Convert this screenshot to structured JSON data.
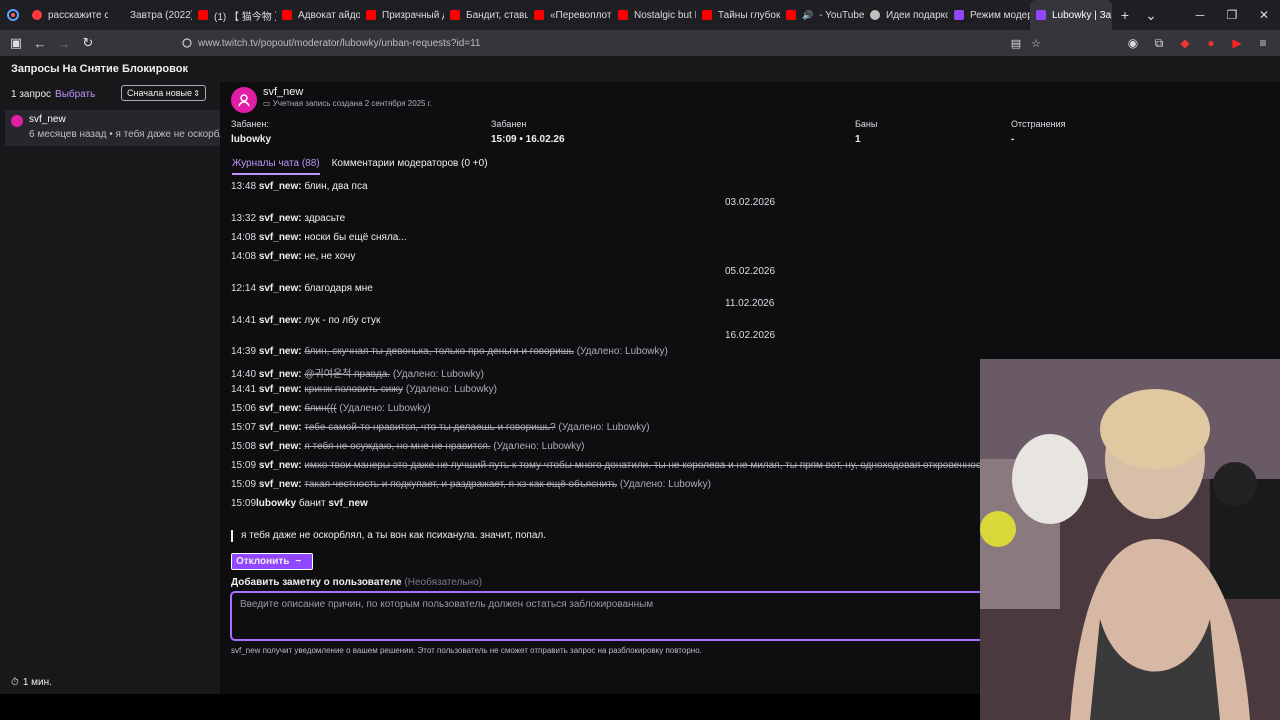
{
  "browser": {
    "tabs": [
      {
        "label": "расскажите са",
        "color": "#ff3b3b"
      },
      {
        "label": "Завтра (2022)",
        "color": "#ffffff"
      },
      {
        "label": "(1) 【 猫今物 】",
        "color": "#ff0000"
      },
      {
        "label": "Адвокат айдол",
        "color": "#ff0000"
      },
      {
        "label": "Призрачный д",
        "color": "#ff0000"
      },
      {
        "label": "Бандит, ставш",
        "color": "#ff0000"
      },
      {
        "label": "«Перевоплоти",
        "color": "#ff0000"
      },
      {
        "label": "Nostalgic but N",
        "color": "#ff0000"
      },
      {
        "label": "Тайны глубок",
        "color": "#ff0000"
      },
      {
        "label": "- YouTube",
        "color": "#ff0000"
      },
      {
        "label": "Идеи подарко",
        "color": "#c0c0c0"
      },
      {
        "label": "Режим модера",
        "color": "#9146ff"
      },
      {
        "label": "Lubowky | Зa",
        "color": "#9146ff"
      }
    ],
    "url": "www.twitch.tv/popout/moderator/lubowky/unban-requests?id=11"
  },
  "page": {
    "title": "Запросы На Снятие Блокировок"
  },
  "sidebar": {
    "count": "1 запрос",
    "select": "Выбрать",
    "sort": "Сначала новые",
    "request": {
      "name": "svf_new",
      "meta": "6 месяцев назад • я тебя даже не оскорбл"
    },
    "timer": "1 мин."
  },
  "user": {
    "name": "svf_new",
    "created": "Учетная запись создана 2 сентября 2025 г.",
    "banned_by_label": "Забанен:",
    "banned_by": "lubowky",
    "banned_at_label": "Забанен",
    "banned_at": "15:09 • 16.02.26",
    "bans_label": "Баны",
    "bans": "1",
    "timeouts_label": "Отстранения",
    "timeouts": "-"
  },
  "tabs": {
    "chat_logs": "Журналы чата (88)",
    "mod_comments": "Комментарии модераторов (0 +0)"
  },
  "log": {
    "lines": [
      {
        "ts": "13:48",
        "user": "svf_new:",
        "text": "блин, два пса",
        "deleted": false,
        "by": ""
      },
      {
        "ts": "13:32",
        "user": "svf_new:",
        "text": "здрасьте",
        "deleted": false,
        "by": ""
      },
      {
        "ts": "14:08",
        "user": "svf_new:",
        "text": "носки бы ещё сняла...",
        "deleted": false,
        "by": ""
      },
      {
        "ts": "14:08",
        "user": "svf_new:",
        "text": "не, не хочу",
        "deleted": false,
        "by": ""
      },
      {
        "ts": "12:14",
        "user": "svf_new:",
        "text": "благодаря мне",
        "deleted": false,
        "by": ""
      },
      {
        "ts": "14:41",
        "user": "svf_new:",
        "text": "лук - по лбу стук",
        "deleted": false,
        "by": ""
      },
      {
        "ts": "14:39",
        "user": "svf_new:",
        "text": "блин, скучная ты девонька, только про деньги и говоришь",
        "deleted": true,
        "by": "(Удалено: Lubowky)"
      },
      {
        "ts": "14:40",
        "user": "svf_new:",
        "text": "@귀여운척 правда.",
        "deleted": true,
        "by": "(Удалено: Lubowky)"
      },
      {
        "ts": "14:41",
        "user": "svf_new:",
        "text": "кринж половить сижу",
        "deleted": true,
        "by": "(Удалено: Lubowky)"
      },
      {
        "ts": "15:06",
        "user": "svf_new:",
        "text": "блин(((",
        "deleted": true,
        "by": "(Удалено: Lubowky)"
      },
      {
        "ts": "15:07",
        "user": "svf_new:",
        "text": "тебе самой-то нравится, что ты делаешь и говоришь?",
        "deleted": true,
        "by": "(Удалено: Lubowky)"
      },
      {
        "ts": "15:08",
        "user": "svf_new:",
        "text": "я тебя не осуждаю, но мне не нравится.",
        "deleted": true,
        "by": "(Удалено: Lubowky)"
      },
      {
        "ts": "15:09",
        "user": "svf_new:",
        "text": "имхо твои манеры это даже не лучший путь к тому чтобы много донатили. ты не королева и не милая, ты прям вот, ну, одноходовая откровенность",
        "deleted": true,
        "by": ""
      },
      {
        "ts": "15:09",
        "user": "svf_new:",
        "text": "такая честность и подкупает, и раздражает, я хз как ещё объяснить",
        "deleted": true,
        "by": "(Удалено: Lubowky)"
      },
      {
        "ts": "15:09",
        "user": "lubowky",
        "text": "банит",
        "deleted": false,
        "by": "svf_new"
      }
    ],
    "dates": [
      "03.02.2026",
      "05.02.2026",
      "11.02.2026",
      "16.02.2026"
    ]
  },
  "request": {
    "message": "я тебя даже не оскорблял, а ты вон как психанула. значит, попал.",
    "deny_label": "Отклонить",
    "note_label": "Добавить заметку о пользователе",
    "note_optional": "(Необязательно)",
    "note_placeholder": "Введите описание причин, по которым пользователь должен остаться заблокированным",
    "note_info": "svf_new получит уведомление о вашем решении. Этот пользователь не сможет отправить запрос на разблокировку повторно."
  }
}
